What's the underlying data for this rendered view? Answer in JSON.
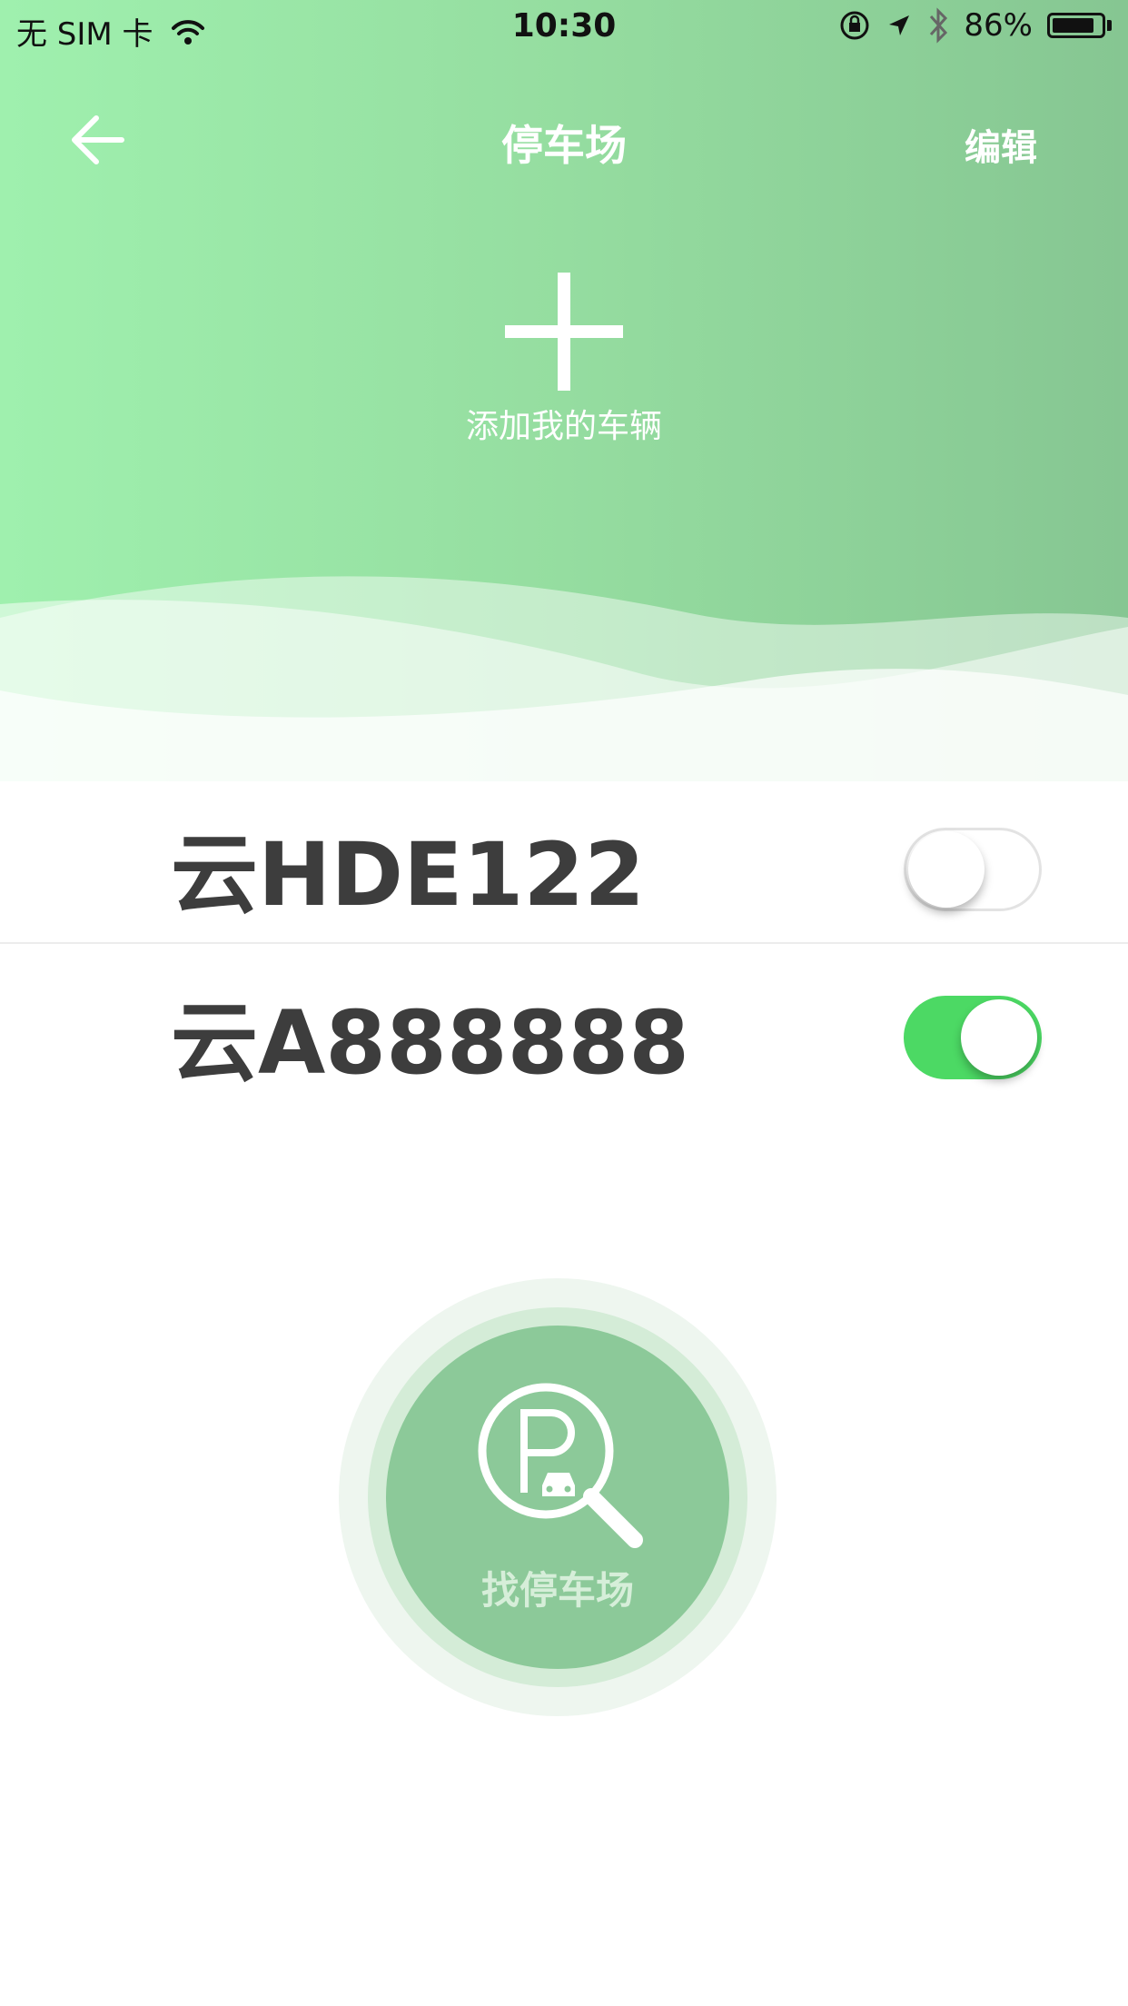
{
  "status_bar": {
    "carrier": "无 SIM 卡",
    "time": "10:30",
    "battery": "86%",
    "battery_level": 0.86
  },
  "nav": {
    "title": "停车场",
    "edit_label": "编辑",
    "back_icon": "arrow-left-icon"
  },
  "add_vehicle": {
    "label": "添加我的车辆",
    "icon": "plus-icon"
  },
  "vehicles": [
    {
      "plate": "云HDE122",
      "enabled": false
    },
    {
      "plate": "云A888888",
      "enabled": true
    }
  ],
  "find_parking": {
    "label": "找停车场",
    "icon": "parking-search-icon"
  },
  "colors": {
    "header_start": "#9ff0ae",
    "header_end": "#86c692",
    "toggle_on": "#4cd964",
    "button_green": "#8cc999"
  }
}
